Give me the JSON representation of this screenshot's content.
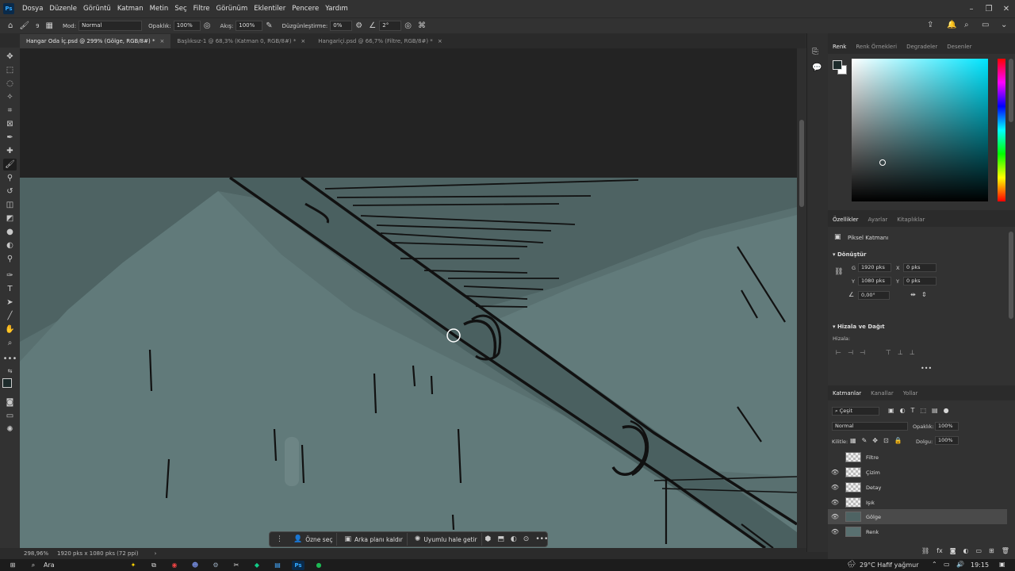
{
  "menu": {
    "logo": "Ps",
    "items": [
      "Dosya",
      "Düzenle",
      "Görüntü",
      "Katman",
      "Metin",
      "Seç",
      "Filtre",
      "Görünüm",
      "Eklentiler",
      "Pencere",
      "Yardım"
    ]
  },
  "options": {
    "mode_label": "Mod:",
    "mode_value": "Normal",
    "opacity_label": "Opaklık:",
    "opacity_value": "100%",
    "flow_label": "Akış:",
    "flow_value": "100%",
    "smoothing_label": "Düzgünleştirme:",
    "smoothing_value": "0%",
    "angle_value": "2°",
    "brush_size": "9"
  },
  "tabs": [
    {
      "label": "Hangar Oda İç.psd @ 299% (Gölge, RGB/8#) *",
      "close": "×"
    },
    {
      "label": "Başlıksız-1 @ 68,3% (Katman 0, RGB/8#) *",
      "close": "×"
    },
    {
      "label": "Hangariçi.psd @ 66,7% (Filtre, RGB/8#) *",
      "close": "×"
    }
  ],
  "status": {
    "zoom": "298,96%",
    "doc_info": "1920 pks x 1080 pks (72 ppi)",
    "arrow": "›"
  },
  "contextbar": {
    "select_subject": "Özne seç",
    "remove_bg": "Arka planı kaldır",
    "generative": "Uyumlu hale getir",
    "more": "•••"
  },
  "color_panel": {
    "tabs": [
      "Renk",
      "Renk Örnekleri",
      "Degradeler",
      "Desenler"
    ],
    "hue_color": "#00e5ff"
  },
  "properties": {
    "tabs": [
      "Özellikler",
      "Ayarlar",
      "Kitaplıklar"
    ],
    "layer_kind": "Piksel Katmanı",
    "transform_title": "Dönüştür",
    "w_label": "G",
    "w_value": "1920 pks",
    "h_label": "Y",
    "h_value": "1080 pks",
    "x_label": "X",
    "x_value": "0 pks",
    "y_label": "Y",
    "y_value": "0 pks",
    "angle_value": "0,00°",
    "align_title": "Hizala ve Dağıt",
    "align_label": "Hizala:",
    "more": "•••"
  },
  "layers": {
    "tabs": [
      "Katmanlar",
      "Kanallar",
      "Yollar"
    ],
    "filter_label": "Çeşit",
    "blend_mode": "Normal",
    "opacity_label": "Opaklık:",
    "opacity_value": "100%",
    "lock_label": "Kilitle:",
    "fill_label": "Dolgu:",
    "fill_value": "100%",
    "items": [
      {
        "name": "Filtre",
        "visible": false,
        "active": false
      },
      {
        "name": "Çizim",
        "visible": true,
        "active": false
      },
      {
        "name": "Detay",
        "visible": true,
        "active": false
      },
      {
        "name": "Işık",
        "visible": true,
        "active": false
      },
      {
        "name": "Gölge",
        "visible": true,
        "active": true
      },
      {
        "name": "Renk",
        "visible": true,
        "active": false
      }
    ]
  },
  "taskbar": {
    "search": "Ara",
    "weather": "29°C  Hafif yağmur",
    "time": "19:15"
  },
  "icons": {
    "home": "home-icon",
    "brush": "brush-icon",
    "share": "share-icon",
    "bell": "bell-icon",
    "search": "search-icon",
    "workspace": "workspace-icon"
  }
}
